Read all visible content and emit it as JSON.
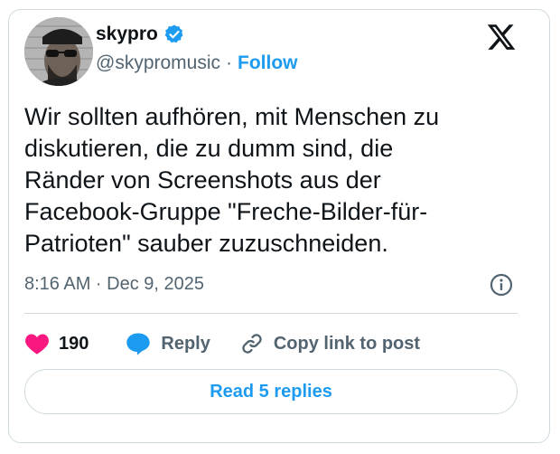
{
  "author": {
    "display_name": "skypro",
    "handle": "@skypromusic",
    "separator": "·",
    "follow_label": "Follow",
    "verified_icon": "verified-badge-icon",
    "avatar_alt": "profile photo of man with sunglasses and beard"
  },
  "tweet": {
    "text": "Wir sollten aufhören, mit Menschen zu\ndiskutieren, die zu dumm sind, die\nRänder von Screenshots aus der\nFacebook-Gruppe \"Freche-Bilder-für-\nPatrioten\" sauber zuzuschneiden.",
    "timestamp": "8:16 AM · Dec 9, 2025"
  },
  "actions": {
    "like_count": "190",
    "reply_label": "Reply",
    "copy_link_label": "Copy link to post"
  },
  "footer": {
    "read_replies_label": "Read 5 replies"
  },
  "colors": {
    "accent": "#1d9bf0",
    "like": "#f91880",
    "text_primary": "#0f1419",
    "text_secondary": "#536471",
    "border": "#cfd9de"
  },
  "icons": [
    "x-logo-icon",
    "verified-badge-icon",
    "info-icon",
    "heart-icon",
    "reply-bubble-icon",
    "link-icon"
  ]
}
